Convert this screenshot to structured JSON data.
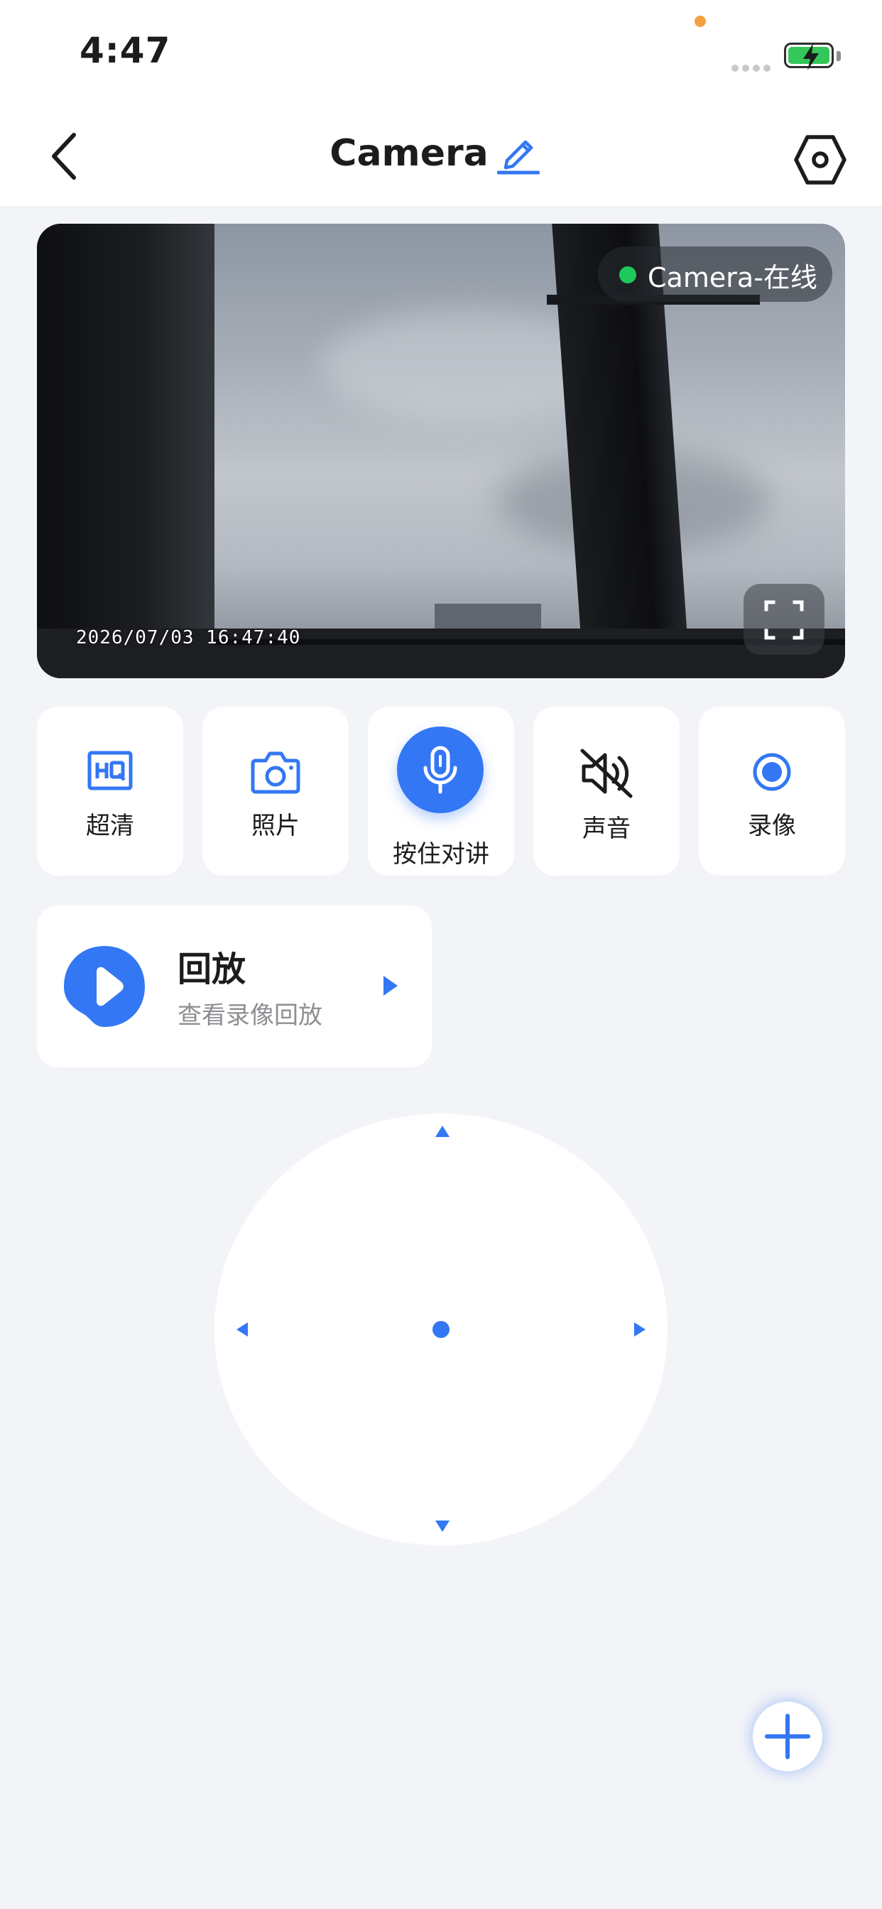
{
  "status_bar": {
    "time": "4:47"
  },
  "header": {
    "title": "Camera"
  },
  "video": {
    "status_label": "Camera-在线",
    "timestamp": "2026/07/03  16:47:40",
    "status_color": "#1ec85b"
  },
  "controls": [
    {
      "label": "超清",
      "icon": "hq-icon"
    },
    {
      "label": "照片",
      "icon": "camera-icon"
    },
    {
      "label": "按住对讲",
      "icon": "microphone-icon"
    },
    {
      "label": "声音",
      "icon": "speaker-muted-icon"
    },
    {
      "label": "录像",
      "icon": "record-icon"
    }
  ],
  "playback": {
    "title": "回放",
    "subtitle": "查看录像回放"
  },
  "accent_color": "#3377f4"
}
